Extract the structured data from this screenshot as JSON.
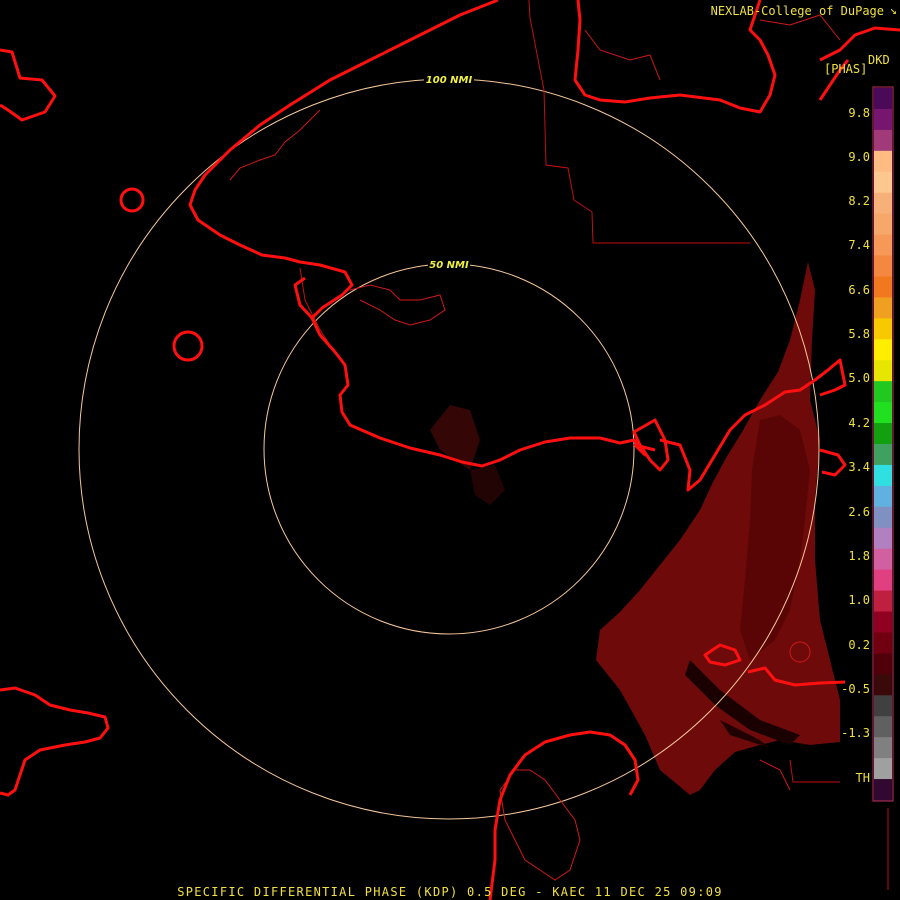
{
  "credit": "NEXLAB-College of DuPage",
  "credit_icon": "corner-arrow-icon",
  "legend": {
    "product_code": "DKD",
    "units": "[PHAS]",
    "ticks": [
      "9.8",
      "9.0",
      "8.2",
      "7.4",
      "6.6",
      "5.8",
      "5.0",
      "4.2",
      "3.4",
      "2.6",
      "1.8",
      "1.0",
      "0.2",
      "-0.5",
      "-1.3",
      "TH"
    ],
    "colors": [
      "#4a0a58",
      "#76166e",
      "#a03a78",
      "#ffbc82",
      "#fdc890",
      "#f7b078",
      "#f6a86a",
      "#f69858",
      "#f48840",
      "#f27820",
      "#f0a020",
      "#f8c800",
      "#ffee00",
      "#e6e600",
      "#20c820",
      "#20e020",
      "#10a010",
      "#40a060",
      "#30e0e0",
      "#60b0e0",
      "#8090c0",
      "#b080c0",
      "#d060a0",
      "#e04080",
      "#c02040",
      "#900020",
      "#700010",
      "#500008",
      "#3a0a0a",
      "#404040",
      "#606060",
      "#808080",
      "#a0a0a0",
      "#300830"
    ]
  },
  "range_rings": [
    {
      "label": "100 NMI"
    },
    {
      "label": "50 NMI"
    }
  ],
  "footer": "SPECIFIC DIFFERENTIAL PHASE (KDP) 0.5 DEG - KAEC 11 DEC 25 09:09"
}
